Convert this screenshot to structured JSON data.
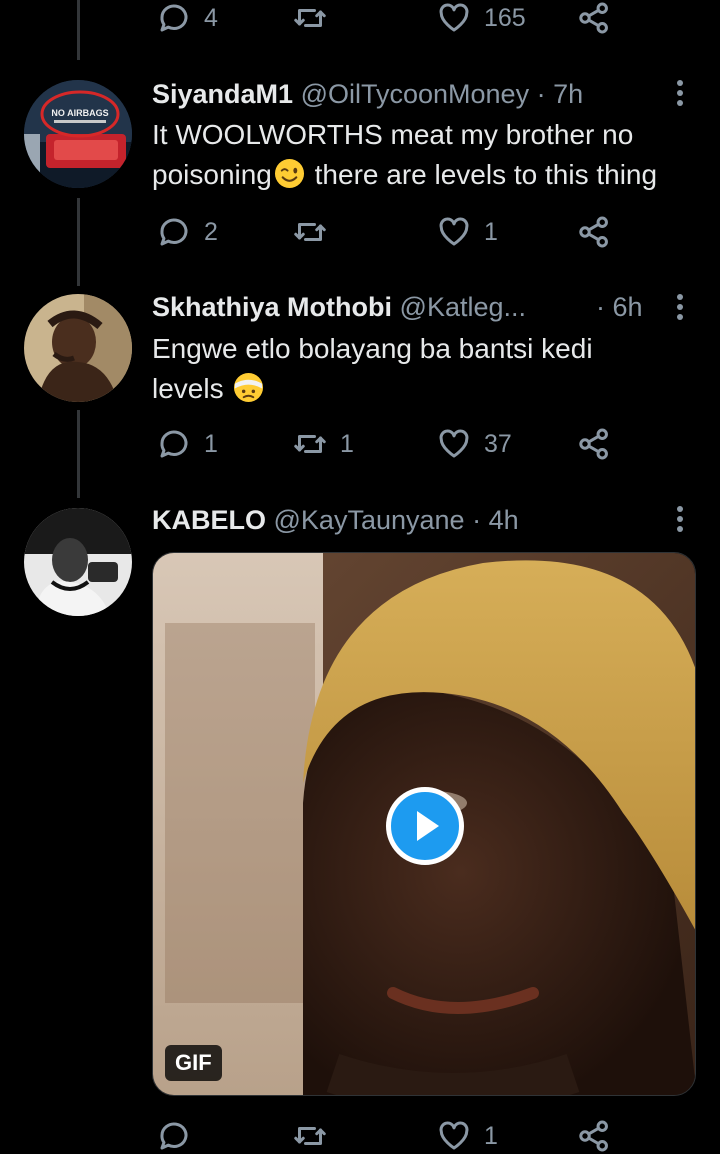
{
  "top_actions": {
    "reply_count": "4",
    "retweet_count": "",
    "like_count": "165"
  },
  "tweets": [
    {
      "name": "SiyandaM1",
      "handle": "@OilTycoonMoney",
      "dot": "·",
      "time": "7h",
      "text_1": "It WOOLWORTHS meat my brother no poisoning",
      "text_2": " there are levels to this thing",
      "emoji": "winking-face",
      "avatar_text": "NO AIRBAGS",
      "reply_count": "2",
      "retweet_count": "",
      "like_count": "1"
    },
    {
      "name": "Skhathiya Mothobi",
      "handle": "@Katleg...",
      "dot": "·",
      "time": "6h",
      "text_1": "Engwe etlo bolayang ba bantsi kedi levels",
      "emoji": "face-with-head-bandage",
      "reply_count": "1",
      "retweet_count": "1",
      "like_count": "37"
    },
    {
      "name": "KABELO",
      "handle": "@KayTaunyane",
      "dot": "·",
      "time": "4h",
      "media_badge": "GIF",
      "reply_count": "",
      "retweet_count": "",
      "like_count": "1"
    }
  ],
  "colors": {
    "background": "#000000",
    "text": "#e7e9ea",
    "muted": "#8b98a5",
    "accent": "#1d9bf0"
  },
  "icons": [
    "reply-icon",
    "retweet-icon",
    "like-icon",
    "share-icon",
    "more-icon",
    "play-icon"
  ]
}
